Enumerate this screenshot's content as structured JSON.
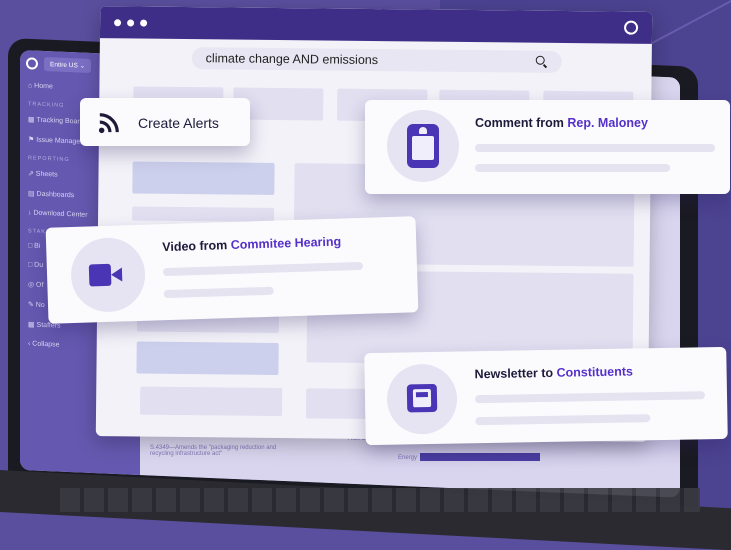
{
  "laptop_app": {
    "region": "Entire US ⌄",
    "sidebar": [
      {
        "type": "item",
        "label": "⌂ Home"
      },
      {
        "type": "section",
        "label": "TRACKING"
      },
      {
        "type": "item",
        "label": "▦ Tracking Boards"
      },
      {
        "type": "item",
        "label": "⚑ Issue Management"
      },
      {
        "type": "section",
        "label": "REPORTING"
      },
      {
        "type": "item",
        "label": "⇗ Sheets"
      },
      {
        "type": "item",
        "label": "▤ Dashboards"
      },
      {
        "type": "item",
        "label": "↓ Download Center"
      },
      {
        "type": "section",
        "label": "STAKE"
      },
      {
        "type": "item",
        "label": "□ Bi"
      },
      {
        "type": "item",
        "label": "□ Du"
      },
      {
        "type": "item",
        "label": "◎ Of"
      },
      {
        "type": "item",
        "label": "✎ No"
      },
      {
        "type": "item",
        "label": "▦ Staffers"
      },
      {
        "type": "item",
        "label": "‹ Collapse"
      }
    ],
    "base_text": "S.4349—Amends the \"packaging reduction and recycling infrastructure act\"",
    "base_hide": "Hide 2",
    "base_energy": "Energy"
  },
  "search": {
    "query": "climate change AND emissions"
  },
  "cards": {
    "alerts": {
      "title": "Create Alerts"
    },
    "comment": {
      "title_prefix": "Comment from ",
      "title_accent": "Rep. Maloney"
    },
    "video": {
      "title_prefix": "Video from ",
      "title_accent": "Commitee Hearing"
    },
    "newsletter": {
      "title_prefix": "Newsletter to ",
      "title_accent": "Constituents"
    }
  },
  "colors": {
    "brand": "#3e2e87",
    "accent": "#5530c9",
    "icon": "#4a36b4"
  }
}
